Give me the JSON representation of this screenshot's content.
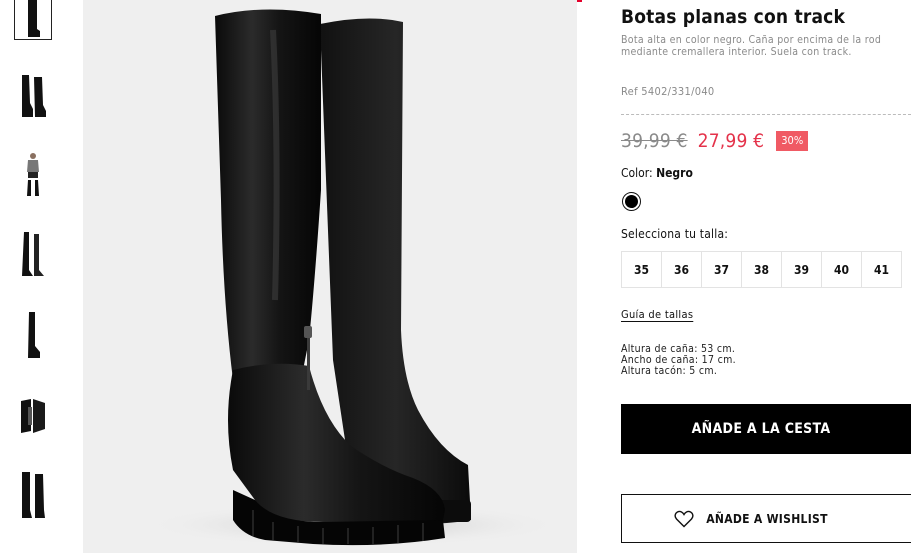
{
  "product": {
    "title": "Botas planas con track",
    "description_line1": "Bota alta en color negro. Caña por encima de la rod",
    "description_line2": "mediante cremallera interior. Suela con track.",
    "reference": "Ref 5402/331/040",
    "old_price": "39,99 €",
    "new_price": "27,99 €",
    "discount": "30%"
  },
  "color": {
    "label": "Color:",
    "value": "Negro",
    "swatch_hex": "#000000"
  },
  "sizes": {
    "label": "Selecciona tu talla:",
    "options": [
      "35",
      "36",
      "37",
      "38",
      "39",
      "40",
      "41"
    ]
  },
  "size_guide": "Guía de tallas",
  "measurements": [
    "Altura de caña: 53 cm.",
    "Ancho de caña: 17 cm.",
    "Altura tacón: 5 cm."
  ],
  "buttons": {
    "add_to_cart": "AÑADE A LA CESTA",
    "add_to_wishlist": "AÑADE A WISHLIST"
  },
  "colors": {
    "accent_red": "#e4002b",
    "sale_price": "#e4324a",
    "discount_badge": "#f05a64"
  }
}
